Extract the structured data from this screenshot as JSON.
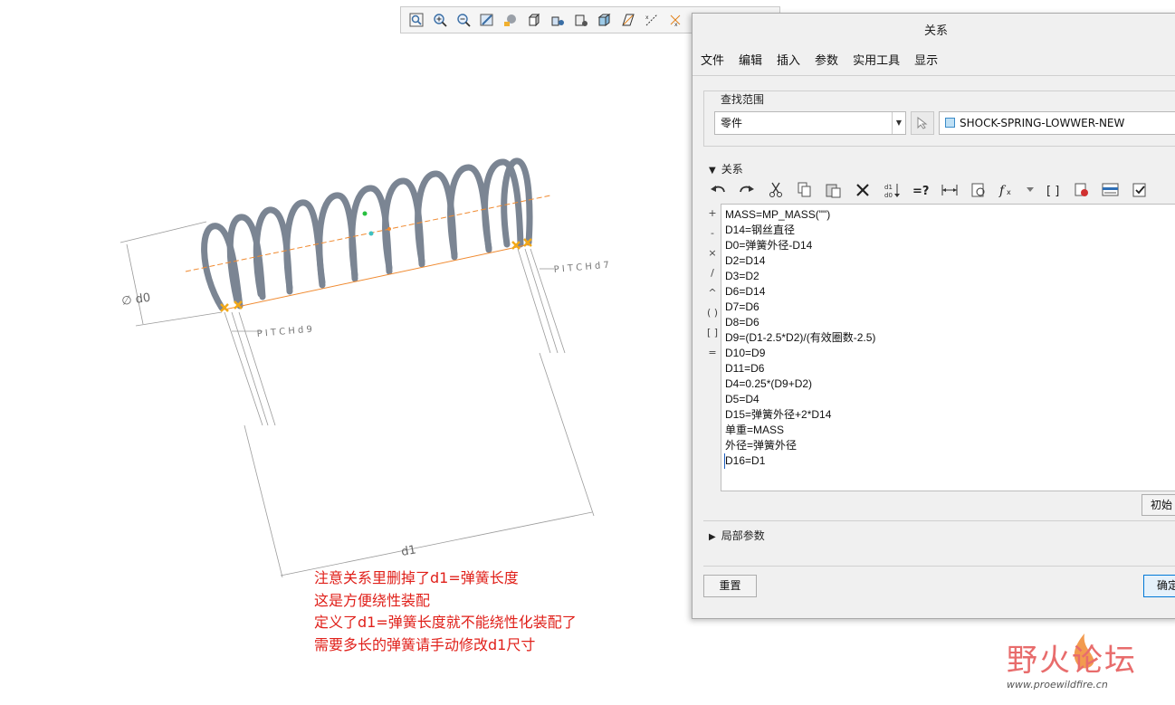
{
  "toolbar": {
    "icons": [
      "zoom-fit-icon",
      "zoom-in-icon",
      "zoom-out-icon",
      "repaint-icon",
      "shading-icon",
      "view-orient-icon",
      "saved-views-icon",
      "camera-icon",
      "display-style-icon",
      "datum-plane-icon",
      "datum-axis-icon",
      "point-display-icon",
      "csys-display-icon"
    ]
  },
  "model": {
    "dim_d0": "∅ d0",
    "dim_d1": "d1",
    "pitch_left": "P I T C H d 9",
    "pitch_right": "P I T C H d 7"
  },
  "dialog": {
    "title": "关系",
    "menus": [
      "文件",
      "编辑",
      "插入",
      "参数",
      "实用工具",
      "显示"
    ],
    "scope_label": "查找范围",
    "scope_type": "零件",
    "scope_model": "SHOCK-SPRING-LOWWER-NEW",
    "relations_header": "关系",
    "side_ops": [
      "+",
      "-",
      "×",
      "/",
      "^",
      "( )",
      "[ ]",
      "="
    ],
    "relations": [
      "MASS=MP_MASS(\"\")",
      "D14=钢丝直径",
      "D0=弹簧外径-D14",
      "D2=D14",
      "D3=D2",
      "D6=D14",
      "D7=D6",
      "D8=D6",
      "D9=(D1-2.5*D2)/(有效圈数-2.5)",
      "D10=D9",
      "D11=D6",
      "D4=0.25*(D9+D2)",
      "D5=D4",
      "D15=弹簧外径+2*D14",
      "单重=MASS",
      "外径=弹簧外径",
      "D16=D1"
    ],
    "init_button": "初始",
    "local_params": "局部参数",
    "reset_button": "重置",
    "ok_button": "确定"
  },
  "annotation": {
    "lines": [
      "注意关系里删掉了d1=弹簧长度",
      "这是方便绕性装配",
      "定义了d1=弹簧长度就不能绕性化装配了",
      "需要多长的弹簧请手动修改d1尺寸"
    ],
    "color": "#e0201a"
  },
  "watermark": {
    "brand": "野火论坛",
    "url": "www.proewildfire.cn"
  }
}
